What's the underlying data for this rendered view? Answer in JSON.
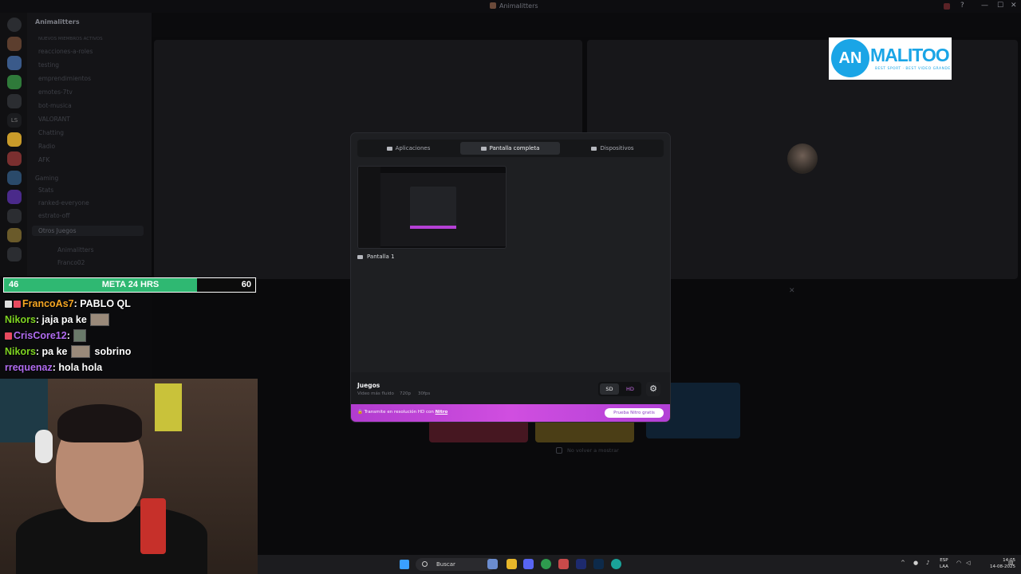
{
  "window": {
    "title": "Animalitters",
    "controls": [
      "—",
      "☐",
      "✕"
    ]
  },
  "sidebar": {
    "server_name": "Animalitters",
    "channels": [
      {
        "label": "NUEVOS MIEMBROS ACTIVOS",
        "prefix": "#"
      },
      {
        "label": "reacciones-a-roles",
        "prefix": "#"
      },
      {
        "label": "testing",
        "prefix": "#"
      },
      {
        "label": "emprendimientos",
        "prefix": "#"
      },
      {
        "label": "emotes-7tv",
        "prefix": "#"
      },
      {
        "label": "bot-musica",
        "prefix": "#"
      },
      {
        "label": "VALORANT",
        "prefix": "🔊"
      },
      {
        "label": "Chatting",
        "prefix": "🔊"
      },
      {
        "label": "Radio",
        "prefix": "🔊"
      },
      {
        "label": "AFK",
        "prefix": "🔊"
      },
      {
        "label": "Gaming",
        "prefix": "⌄"
      },
      {
        "label": "Stats",
        "prefix": "#"
      },
      {
        "label": "ranked-everyone",
        "prefix": "#"
      },
      {
        "label": "estrato-off",
        "prefix": "#"
      }
    ],
    "active_voice": "Otros Juegos",
    "voice_users": [
      "Animalitters",
      "Franco02"
    ]
  },
  "brand": {
    "logo_initials": "AN",
    "logo_word": "MALITOO",
    "logo_tag": "BEST SPORT · BEST VIDEO GRANDE"
  },
  "share_modal": {
    "tabs": [
      {
        "label": "Aplicaciones",
        "active": false
      },
      {
        "label": "Pantalla completa",
        "active": true
      },
      {
        "label": "Dispositivos",
        "active": false
      }
    ],
    "source_label": "Pantalla 1",
    "section_title": "Juegos",
    "meta": [
      "Video más fluido",
      "720p",
      "30fps"
    ],
    "quality_sd": "SD",
    "quality_hd": "HD",
    "nitro_message_prefix": "Transmite en resolución HD con",
    "nitro_link": "Nitro",
    "nitro_button": "Prueba Nitro gratis"
  },
  "background": {
    "no_show_again": "No volver a mostrar"
  },
  "stream_overlay": {
    "goal": {
      "current": "46",
      "label": "META 24 HRS",
      "target": "60",
      "progress": 0.767
    },
    "chat": [
      {
        "user": "FrancoAs7",
        "color": "#f5a623",
        "text": "PABLO QL",
        "emote": false
      },
      {
        "user": "Nikors",
        "color": "#7ed321",
        "text": "jaja pa ke",
        "emote": true
      },
      {
        "user": "CrisCore12",
        "color": "#b16cf0",
        "text": "",
        "emote": true
      },
      {
        "user": "Nikors",
        "color": "#7ed321",
        "text": "pa ke",
        "emote": true,
        "after": "sobrino"
      },
      {
        "user": "rrequenaz",
        "color": "#b16cf0",
        "text": "hola hola",
        "emote": false
      }
    ]
  },
  "taskbar": {
    "search_placeholder": "Buscar",
    "language_line1": "ESP",
    "language_line2": "LAA",
    "time": "14:05",
    "date": "14-08-2025"
  }
}
